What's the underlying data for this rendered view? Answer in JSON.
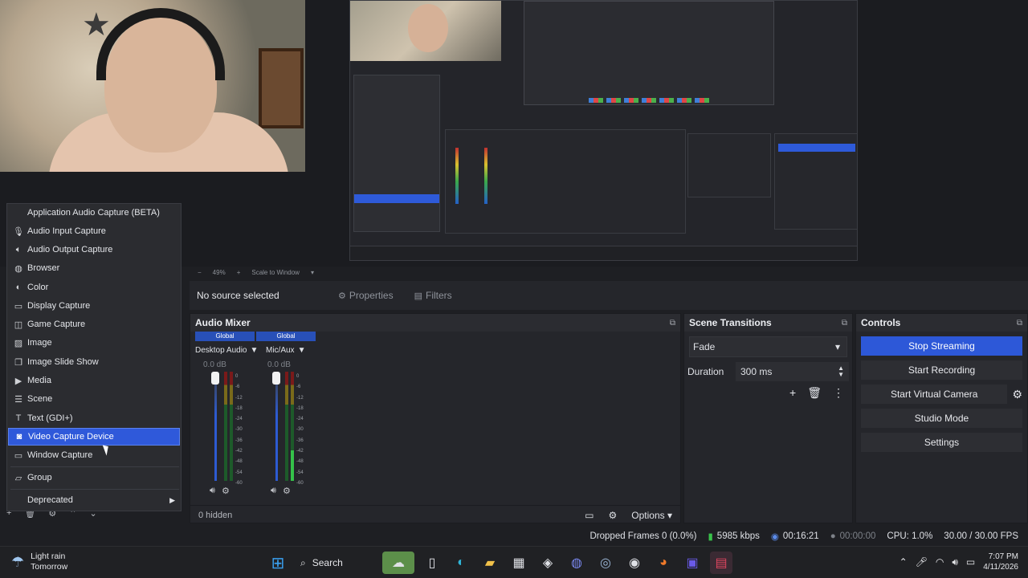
{
  "context_menu": {
    "items": [
      {
        "label": "Application Audio Capture (BETA)",
        "icon": "window-icon"
      },
      {
        "label": "Audio Input Capture",
        "icon": "microphone-icon"
      },
      {
        "label": "Audio Output Capture",
        "icon": "speaker-icon"
      },
      {
        "label": "Browser",
        "icon": "globe-icon"
      },
      {
        "label": "Color",
        "icon": "palette-icon"
      },
      {
        "label": "Display Capture",
        "icon": "monitor-icon"
      },
      {
        "label": "Game Capture",
        "icon": "gamepad-icon"
      },
      {
        "label": "Image",
        "icon": "image-icon"
      },
      {
        "label": "Image Slide Show",
        "icon": "slideshow-icon"
      },
      {
        "label": "Media",
        "icon": "play-icon"
      },
      {
        "label": "Scene",
        "icon": "scene-icon"
      },
      {
        "label": "Text (GDI+)",
        "icon": "text-icon"
      },
      {
        "label": "Video Capture Device",
        "icon": "camera-icon"
      },
      {
        "label": "Window Capture",
        "icon": "window-capture-icon"
      },
      {
        "label": "Group",
        "icon": "folder-icon"
      },
      {
        "label": "Deprecated",
        "icon": ""
      }
    ],
    "selected_label": "Video Capture Device"
  },
  "scale_bar": {
    "zoom": "49%",
    "mode": "Scale to Window"
  },
  "context_bar": {
    "no_source": "No source selected",
    "properties": "Properties",
    "filters": "Filters"
  },
  "audio_mixer": {
    "title": "Audio Mixer",
    "channels": [
      {
        "tag": "Global",
        "name": "Desktop Audio",
        "db": "0.0 dB"
      },
      {
        "tag": "Global",
        "name": "Mic/Aux",
        "db": "0.0 dB"
      }
    ],
    "ticks": [
      "0",
      "-6",
      "-12",
      "-18",
      "-24",
      "-30",
      "-36",
      "-42",
      "-48",
      "-54",
      "-60"
    ],
    "hidden": "0 hidden",
    "options": "Options"
  },
  "scene_transitions": {
    "title": "Scene Transitions",
    "transition": "Fade",
    "duration_label": "Duration",
    "duration_value": "300 ms"
  },
  "controls": {
    "title": "Controls",
    "stop_streaming": "Stop Streaming",
    "start_recording": "Start Recording",
    "start_virtual_camera": "Start Virtual Camera",
    "studio_mode": "Studio Mode",
    "settings": "Settings"
  },
  "status_bar": {
    "dropped_frames": "Dropped Frames 0 (0.0%)",
    "bitrate": "5985 kbps",
    "stream_time": "00:16:21",
    "record_time": "00:00:00",
    "cpu": "CPU: 1.0%",
    "fps": "30.00 / 30.00 FPS"
  },
  "taskbar": {
    "weather_line1": "Light rain",
    "weather_line2": "Tomorrow",
    "search": "Search",
    "time": "7:07 PM",
    "date": "4/11/2026"
  },
  "colors": {
    "accent": "#2d58d8",
    "background": "#1e1f23",
    "panel": "#25262b"
  }
}
